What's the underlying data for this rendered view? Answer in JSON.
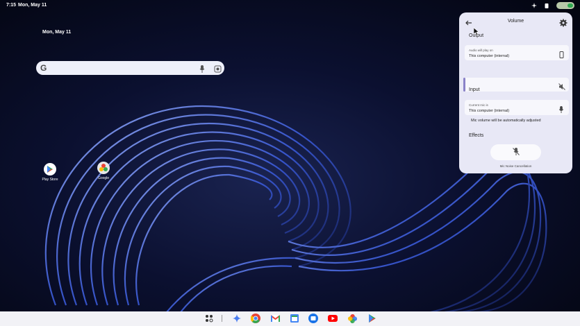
{
  "status_bar": {
    "time": "7:15",
    "date": "Mon, May 11",
    "icons": [
      "sparkle-icon",
      "battery-saver-icon",
      "wifi-icon",
      "battery-icon"
    ]
  },
  "desktop": {
    "date": "Mon, May 11",
    "search": {
      "logo": "G",
      "icons": [
        "mic-icon",
        "lens-icon"
      ]
    },
    "apps": [
      {
        "label": "Play Store",
        "icon": "play-store-icon"
      },
      {
        "label": "Google",
        "icon": "google-icon"
      }
    ]
  },
  "volume_panel": {
    "title": "Volume",
    "output": {
      "heading": "Output",
      "device_label": "Audio will play on",
      "device_name": "This computer (internal)",
      "device_icon": "phone-icon",
      "mute_icon": "volume-off-icon"
    },
    "input": {
      "heading": "Input",
      "device_label": "Current mic is",
      "device_name": "This computer (internal)",
      "device_icon": "mic-icon",
      "note": "Mic volume will be automatically adjusted"
    },
    "effects": {
      "heading": "Effects",
      "toggle_label": "Mic Noise Cancellation",
      "toggle_icon": "mic-noise-cancel-icon"
    }
  },
  "shelf": {
    "apps": [
      "launcher-icon",
      "gemini-icon",
      "chrome-icon",
      "gmail-icon",
      "calendar-icon",
      "files-icon",
      "youtube-icon",
      "photos-icon",
      "play-store-icon"
    ]
  }
}
